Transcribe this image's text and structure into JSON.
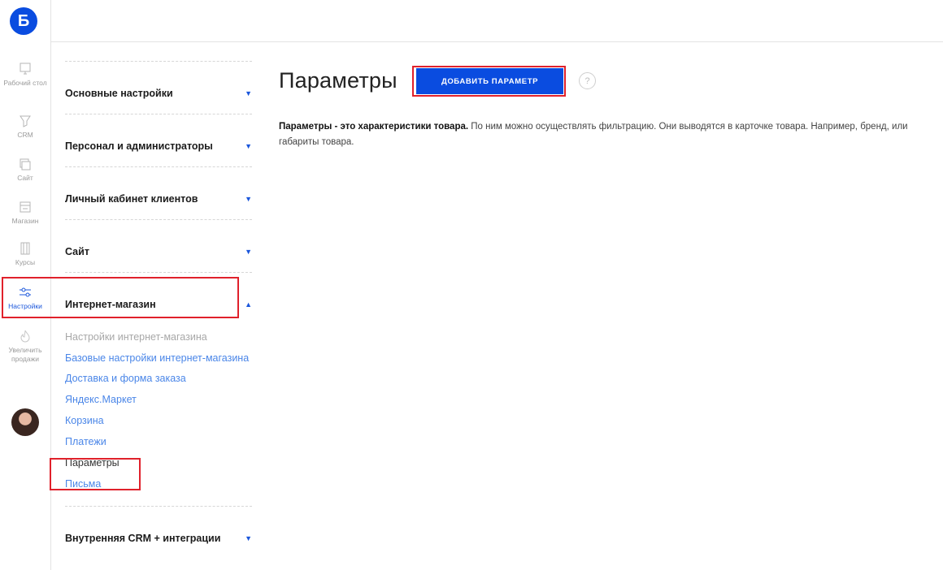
{
  "app": {
    "logo_letter": "Б"
  },
  "rail": {
    "items": [
      {
        "label": "Рабочий стол",
        "icon": "monitor-icon"
      },
      {
        "label": "CRM",
        "icon": "funnel-icon"
      },
      {
        "label": "Сайт",
        "icon": "pages-icon"
      },
      {
        "label": "Магазин",
        "icon": "store-icon"
      },
      {
        "label": "Курсы",
        "icon": "book-icon"
      },
      {
        "label": "Настройки",
        "icon": "sliders-icon",
        "active": true
      },
      {
        "label": "Увеличить продажи",
        "icon": "flame-icon"
      }
    ]
  },
  "settings": {
    "sections": [
      {
        "label": "Основные настройки",
        "expanded": false
      },
      {
        "label": "Персонал и администраторы",
        "expanded": false
      },
      {
        "label": "Личный кабинет клиентов",
        "expanded": false
      },
      {
        "label": "Сайт",
        "expanded": false
      },
      {
        "label": "Интернет-магазин",
        "expanded": true
      },
      {
        "label": "Внутренняя CRM + интеграции",
        "expanded": false
      }
    ],
    "shop_subitems": [
      "Настройки интернет-магазина",
      "Базовые настройки интернет-магазина",
      "Доставка и форма заказа",
      "Яндекс.Маркет",
      "Корзина",
      "Платежи",
      "Параметры",
      "Письма"
    ],
    "arrow_down": "▼",
    "arrow_up": "▲"
  },
  "main": {
    "title": "Параметры",
    "add_button": "ДОБАВИТЬ ПАРАМЕТР",
    "help": "?",
    "description_bold": "Параметры - это характеристики товара.",
    "description_text": " По ним можно осуществлять фильтрацию. Они выводятся в карточке товара. Например, бренд, или габариты товара."
  },
  "colors": {
    "accent": "#0a4ce0",
    "link": "#4a86e8",
    "highlight": "#e0212b"
  }
}
